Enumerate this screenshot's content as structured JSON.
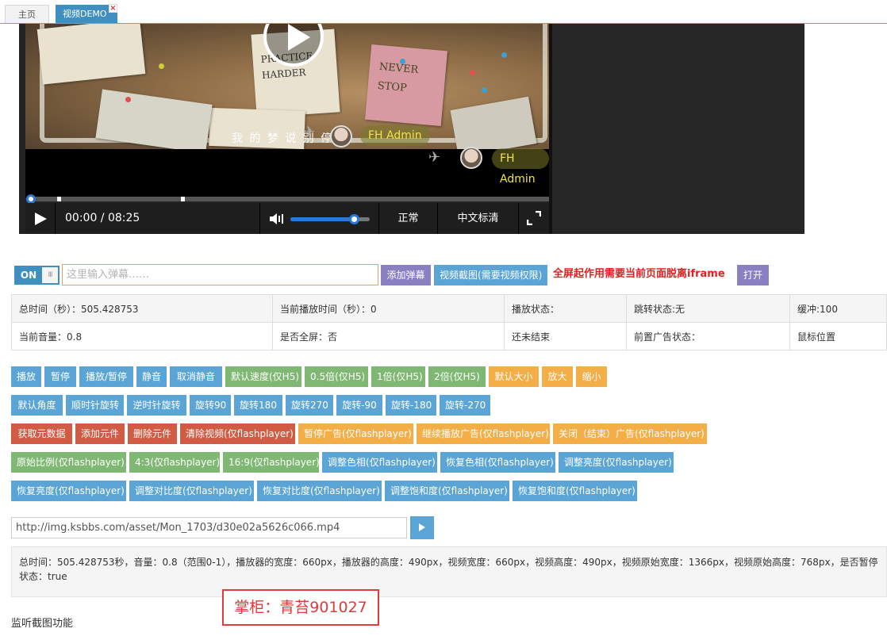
{
  "tabs": [
    {
      "label": "主页",
      "active": false
    },
    {
      "label": "视频DEMO",
      "active": true,
      "close": "×"
    }
  ],
  "player": {
    "subtitle_text": "我 的 梦 说 别 停 留",
    "danmu_name": "FH Admin",
    "time": "00:00 / 08:25",
    "volume_level": 0.8,
    "progress_level": 0,
    "rate_label": "正常",
    "definition_label": "中文标清",
    "video_text": {
      "note1": "PRACTICE HARDER",
      "note2": "NEVER STOP"
    }
  },
  "danmu_bar": {
    "toggle_label": "ON",
    "toggle_grip": "III",
    "input_placeholder": "这里输入弹幕……",
    "send_button": "添加弹幕",
    "screenshot_button": "视频截图(需要视频权限)",
    "fullscreen_warning": "全屏起作用需要当前页面脱离iframe",
    "open_button": "打开"
  },
  "status": {
    "row1": [
      "总时间（秒）：505.428753",
      "当前播放时间（秒）：0",
      "播放状态：",
      "跳转状态:无",
      "缓冲:100"
    ],
    "row2": [
      "当前音量：0.8",
      "是否全屏：否",
      "还未结束",
      "前置广告状态：",
      "鼠标位置"
    ]
  },
  "buttons": {
    "row1": [
      "播放",
      "暂停",
      "播放/暂停",
      "静音",
      "取消静音",
      "默认速度(仅H5)",
      "0.5倍(仅H5)",
      "1倍(仅H5)",
      "2倍(仅H5)",
      "默认大小",
      "放大",
      "缩小"
    ],
    "row2": [
      "默认角度",
      "顺时针旋转",
      "逆时针旋转",
      "旋转90",
      "旋转180",
      "旋转270",
      "旋转-90",
      "旋转-180",
      "旋转-270"
    ],
    "row3": [
      "获取元数据",
      "添加元件",
      "删除元件",
      "清除视频(仅flashplayer)",
      "暂停广告(仅flashplayer)",
      "继续播放广告(仅flashplayer)",
      "关闭（结束）广告(仅flashplayer)"
    ],
    "row4": [
      "原始比例(仅flashplayer)",
      "4:3(仅flashplayer)",
      "16:9(仅flashplayer)",
      "调整色相(仅flashplayer)",
      "恢复色相(仅flashplayer)",
      "调整亮度(仅flashplayer)"
    ],
    "row5": [
      "恢复亮度(仅flashplayer)",
      "调整对比度(仅flashplayer)",
      "恢复对比度(仅flashplayer)",
      "调整饱和度(仅flashplayer)",
      "恢复饱和度(仅flashplayer)"
    ]
  },
  "url_bar": {
    "value": "http://img.ksbbs.com/asset/Mon_1703/d30e02a5626c066.mp4"
  },
  "info_text": "总时间：505.428753秒，音量：0.8（范围0-1），播放器的宽度：660px，播放器的高度：490px，视频宽度：660px，视频高度：490px，视频原始宽度：1366px，视频原始高度：768px，是否暂停状态：true",
  "stamp": "掌柜：青苔901027",
  "footer_label": "监听截图功能",
  "colors": {
    "purple": "#8a7fc0",
    "blue": "#5aa4d6",
    "green": "#7fb873",
    "orange": "#f3ae47",
    "red": "#d25c43",
    "accent": "#3f8fc1"
  }
}
